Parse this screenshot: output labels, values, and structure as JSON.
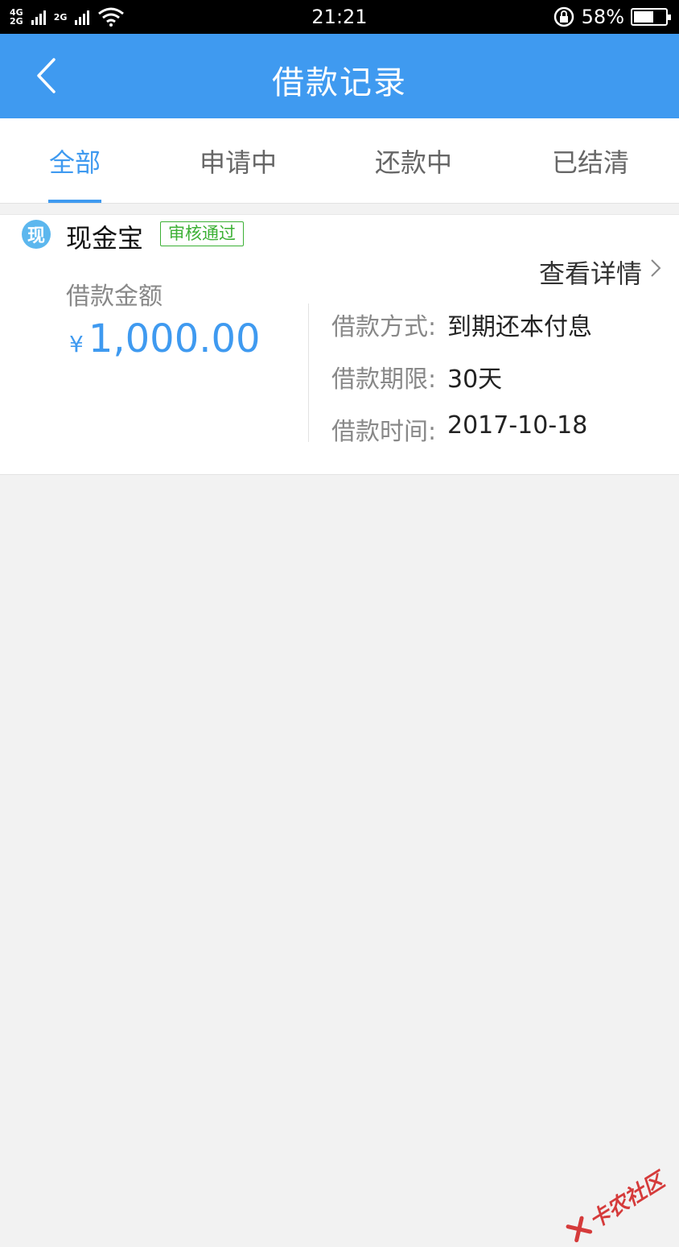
{
  "status_bar": {
    "network_top": "4G",
    "network_bottom": "2G",
    "network2": "2G",
    "time": "21:21",
    "battery_percent": "58%",
    "battery_level": 0.58
  },
  "header": {
    "title": "借款记录",
    "back_icon": "chevron-left-icon"
  },
  "tabs": [
    {
      "label": "全部",
      "active": true
    },
    {
      "label": "申请中",
      "active": false
    },
    {
      "label": "还款中",
      "active": false
    },
    {
      "label": "已结清",
      "active": false
    }
  ],
  "loan": {
    "icon_text": "现",
    "product_name": "现金宝",
    "status": "审核通过",
    "detail_link": "查看详情",
    "amount_label": "借款金额",
    "currency": "¥",
    "amount": "1,000.00",
    "rows": [
      {
        "label": "借款方式:",
        "value": "到期还本付息"
      },
      {
        "label": "借款期限:",
        "value": "30天"
      },
      {
        "label": "借款时间:",
        "value": "2017-10-18"
      }
    ]
  },
  "watermark": {
    "text": "卡农社区"
  },
  "colors": {
    "accent": "#3f9af0",
    "status_green": "#3cb035",
    "watermark_red": "#d53b3b"
  }
}
